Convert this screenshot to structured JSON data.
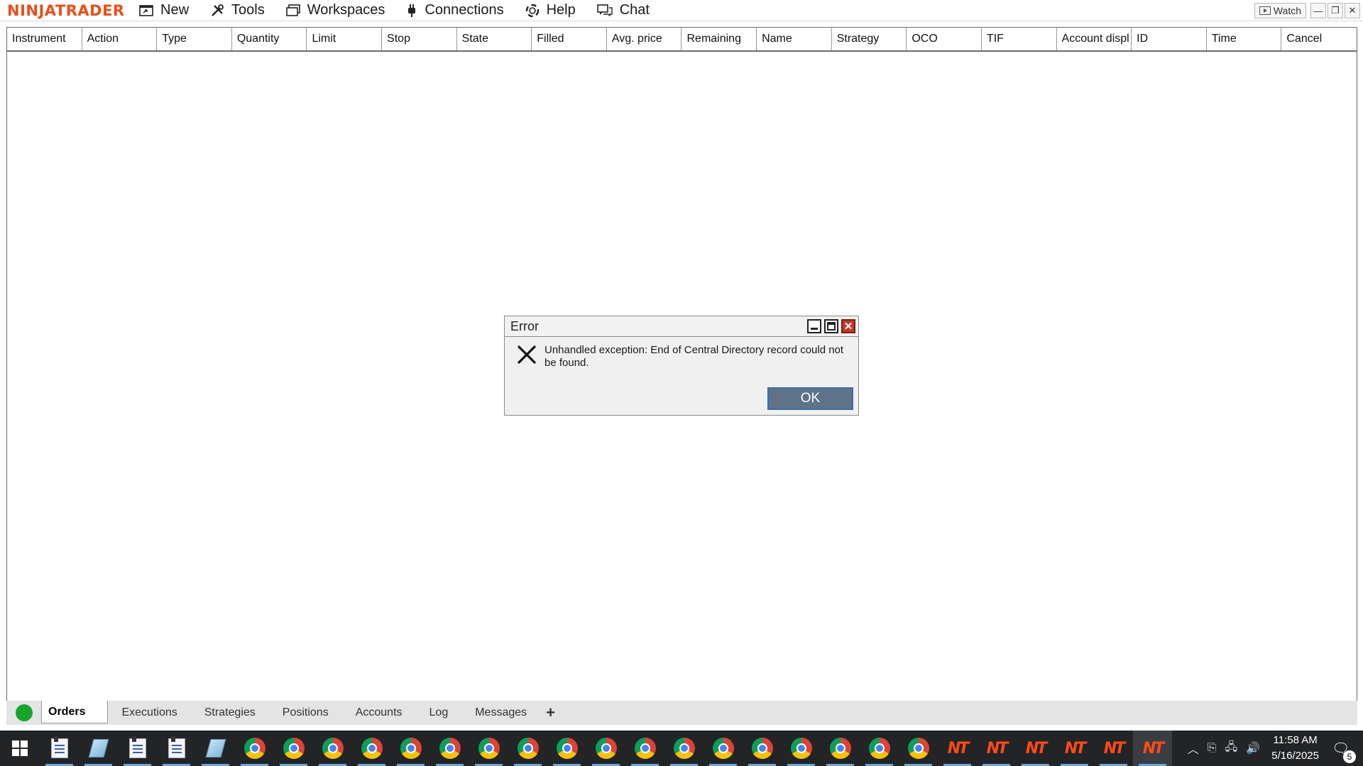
{
  "app": {
    "logo": "NINJATRADER",
    "menu": [
      {
        "label": "New",
        "icon": "new-window-icon"
      },
      {
        "label": "Tools",
        "icon": "tools-icon"
      },
      {
        "label": "Workspaces",
        "icon": "workspaces-icon"
      },
      {
        "label": "Connections",
        "icon": "plug-icon"
      },
      {
        "label": "Help",
        "icon": "lifebuoy-icon"
      },
      {
        "label": "Chat",
        "icon": "chat-icon"
      }
    ],
    "watch_label": "Watch"
  },
  "grid": {
    "columns": [
      "Instrument",
      "Action",
      "Type",
      "Quantity",
      "Limit",
      "Stop",
      "State",
      "Filled",
      "Avg. price",
      "Remaining",
      "Name",
      "Strategy",
      "OCO",
      "TIF",
      "Account displ",
      "ID",
      "Time",
      "Cancel"
    ],
    "rows": []
  },
  "tabs": {
    "status_color": "#15a52d",
    "items": [
      "Orders",
      "Executions",
      "Strategies",
      "Positions",
      "Accounts",
      "Log",
      "Messages"
    ],
    "active": "Orders",
    "add_label": "+"
  },
  "dialog": {
    "title": "Error",
    "message": "Unhandled exception: End of Central Directory record could not be found.",
    "ok_label": "OK"
  },
  "taskbar": {
    "apps": [
      "doc",
      "pad",
      "doc",
      "doc",
      "pad",
      "chrome",
      "chrome",
      "chrome",
      "chrome",
      "chrome",
      "chrome",
      "chrome",
      "chrome",
      "chrome",
      "chrome",
      "chrome",
      "chrome",
      "chrome",
      "chrome",
      "chrome",
      "chrome",
      "chrome",
      "chrome",
      "nt",
      "nt",
      "nt",
      "nt",
      "nt",
      "nt"
    ],
    "time": "11:58 AM",
    "date": "5/16/2025",
    "notification_count": "5"
  },
  "colors": {
    "brand": "#e8501a",
    "ok_button": "#5f7388",
    "taskbar": "#222426"
  }
}
